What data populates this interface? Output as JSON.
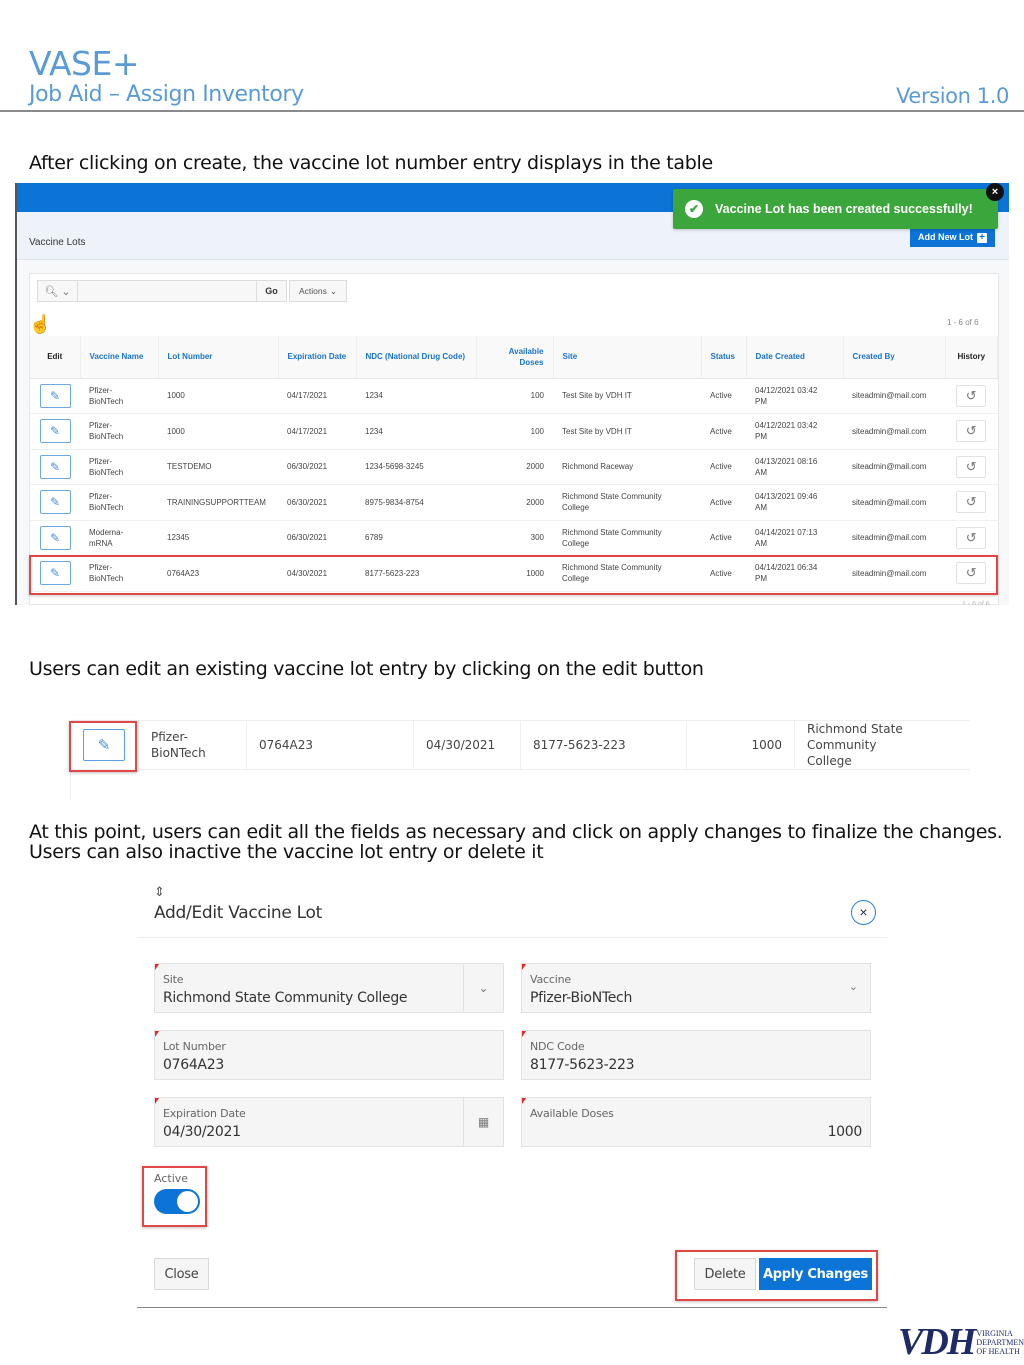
{
  "header": {
    "title": "VASE+",
    "subtitle": "Job Aid – Assign Inventory",
    "version": "Version 1.0"
  },
  "paragraphs": {
    "p1": "After clicking on create, the vaccine lot number entry displays in the table",
    "p2": "Users can edit an existing vaccine lot entry by clicking on the edit button",
    "p3_line1": "At this point, users can edit all the fields as necessary and click on apply changes to finalize the changes.",
    "p3_line2": "Users can also inactive the vaccine lot entry or delete it"
  },
  "screenshot1": {
    "region_title": "Vaccine Lots",
    "add_button": "Add New Lot",
    "toast": "Vaccine Lot has been created successfully!",
    "toast_close": "×",
    "search": {
      "icon": "search-icon",
      "placeholder": "",
      "go": "Go",
      "actions": "Actions"
    },
    "pagination": "1 - 6 of 6",
    "columns": [
      "Edit",
      "Vaccine Name",
      "Lot Number",
      "Expiration Date",
      "NDC (National Drug Code)",
      "Available Doses",
      "Site",
      "Status",
      "Date Created",
      "Created By",
      "History"
    ],
    "rows": [
      {
        "vaccine": [
          "Pfizer-",
          "BioNTech"
        ],
        "lot": "1000",
        "exp": "04/17/2021",
        "ndc": "1234",
        "doses": "100",
        "site": [
          "Test Site by VDH IT",
          ""
        ],
        "status": "Active",
        "created": [
          "04/12/2021 03:42",
          "PM"
        ],
        "by": "siteadmin@mail.com"
      },
      {
        "vaccine": [
          "Pfizer-",
          "BioNTech"
        ],
        "lot": "1000",
        "exp": "04/17/2021",
        "ndc": "1234",
        "doses": "100",
        "site": [
          "Test Site by VDH IT",
          ""
        ],
        "status": "Active",
        "created": [
          "04/12/2021 03:42",
          "PM"
        ],
        "by": "siteadmin@mail.com"
      },
      {
        "vaccine": [
          "Pfizer-",
          "BioNTech"
        ],
        "lot": "TESTDEMO",
        "exp": "06/30/2021",
        "ndc": "1234-5698-3245",
        "doses": "2000",
        "site": [
          "Richmond Raceway",
          ""
        ],
        "status": "Active",
        "created": [
          "04/13/2021 08:16",
          "AM"
        ],
        "by": "siteadmin@mail.com"
      },
      {
        "vaccine": [
          "Pfizer-",
          "BioNTech"
        ],
        "lot": "TRAININGSUPPORTTEAM",
        "exp": "06/30/2021",
        "ndc": "8975-9834-8754",
        "doses": "2000",
        "site": [
          "Richmond State Community",
          "College"
        ],
        "status": "Active",
        "created": [
          "04/13/2021 09:46",
          "AM"
        ],
        "by": "siteadmin@mail.com"
      },
      {
        "vaccine": [
          "Moderna-",
          "mRNA"
        ],
        "lot": "12345",
        "exp": "06/30/2021",
        "ndc": "6789",
        "doses": "300",
        "site": [
          "Richmond State Community",
          "College"
        ],
        "status": "Active",
        "created": [
          "04/14/2021 07:13",
          "AM"
        ],
        "by": "siteadmin@mail.com"
      },
      {
        "vaccine": [
          "Pfizer-",
          "BioNTech"
        ],
        "lot": "0764A23",
        "exp": "04/30/2021",
        "ndc": "8177-5623-223",
        "doses": "1000",
        "site": [
          "Richmond State Community",
          "College"
        ],
        "status": "Active",
        "created": [
          "04/14/2021 06:34",
          "PM"
        ],
        "by": "siteadmin@mail.com"
      }
    ]
  },
  "screenshot2": {
    "vaccine_line1": "Pfizer-",
    "vaccine_line2": "BioNTech",
    "lot": "0764A23",
    "exp": "04/30/2021",
    "ndc": "8177-5623-223",
    "doses": "1000",
    "site_line1": "Richmond State Community",
    "site_line2": "College"
  },
  "dialog": {
    "title": "Add/Edit Vaccine Lot",
    "close_icon": "×",
    "fields": {
      "site": {
        "label": "Site",
        "value": "Richmond State Community College"
      },
      "vaccine": {
        "label": "Vaccine",
        "value": "Pfizer-BioNTech"
      },
      "lot": {
        "label": "Lot Number",
        "value": "0764A23"
      },
      "ndc": {
        "label": "NDC Code",
        "value": "8177-5623-223"
      },
      "exp": {
        "label": "Expiration Date",
        "value": "04/30/2021"
      },
      "doses": {
        "label": "Available Doses",
        "value": "1000"
      }
    },
    "active_label": "Active",
    "active_on": true,
    "buttons": {
      "close": "Close",
      "delete": "Delete",
      "apply": "Apply Changes"
    }
  },
  "footer": {
    "logo_big": "VDH",
    "logo_line1": "VIRGINIA",
    "logo_line2": "DEPARTMENT",
    "logo_line3": "OF HEALTH"
  }
}
